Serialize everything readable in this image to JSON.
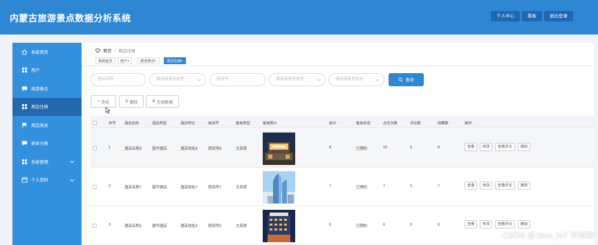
{
  "app": {
    "title": "内蒙古旅游景点数据分析系统"
  },
  "top_buttons": [
    "个人中心",
    "看板",
    "退出登录"
  ],
  "sidebar": {
    "items": [
      {
        "label": "系统首页",
        "icon": "home-icon"
      },
      {
        "label": "用户",
        "icon": "grid-icon"
      },
      {
        "label": "旅游景点",
        "icon": "chat-icon"
      },
      {
        "label": "周边住宿",
        "icon": "grid-icon",
        "active": true
      },
      {
        "label": "周边美食",
        "icon": "flag-icon"
      },
      {
        "label": "美食分类",
        "icon": "chat-icon"
      },
      {
        "label": "系统管理",
        "icon": "grid-icon",
        "expandable": true
      },
      {
        "label": "个人资料",
        "icon": "calendar-icon",
        "expandable": true
      }
    ]
  },
  "breadcrumb": {
    "home": "首页",
    "current": "周边住宿"
  },
  "tabs": [
    {
      "label": "系统首页"
    },
    {
      "label": "用户×"
    },
    {
      "label": "旅游景点×"
    },
    {
      "label": "周边住宿×",
      "active": true
    }
  ],
  "filters": {
    "hotel_name_placeholder": "酒店名称",
    "hotel_type_placeholder": "请选择酒店类型",
    "room_no_placeholder": "房间号",
    "room_type_placeholder": "请选择客房类型",
    "room_status_placeholder": "请选择客房状态",
    "query_label": "查询"
  },
  "actions": {
    "add": "添加",
    "delete": "删除",
    "generate": "生成数据"
  },
  "table": {
    "headers": [
      "序号",
      "酒店名称",
      "酒店类型",
      "酒店地址",
      "房间号",
      "客房类型",
      "客房照片",
      "房价",
      "客房状态",
      "点击次数",
      "评论数",
      "收藏数",
      "操作"
    ],
    "row_buttons": [
      "查看",
      "修改",
      "查看评论",
      "删除"
    ],
    "rows": [
      {
        "index": "1",
        "name": "酒店名称8",
        "type": "豪华酒店",
        "address": "酒店地址8",
        "room": "房间号8",
        "room_type": "大床房",
        "price": "8",
        "status": "已预约",
        "clicks": "10",
        "comments": "0",
        "favorites": "8"
      },
      {
        "index": "2",
        "name": "酒店名称7",
        "type": "豪华酒店",
        "address": "酒店地址7",
        "room": "房间号7",
        "room_type": "大床房",
        "price": "7",
        "status": "已预约",
        "clicks": "7",
        "comments": "0",
        "favorites": "7"
      },
      {
        "index": "3",
        "name": "酒店名称6",
        "type": "豪华酒店",
        "address": "酒店地址6",
        "room": "房间号6",
        "room_type": "大床房",
        "price": "6",
        "status": "已预约",
        "clicks": "6",
        "comments": "0",
        "favorites": "6"
      }
    ]
  },
  "watermark": "CSDN @Java_IoT 攻城狮",
  "colors": {
    "primary": "#2f86d2",
    "sidebar": "#3390de",
    "sidebar_active": "#2368ae",
    "top_button": "#1d67b3"
  }
}
